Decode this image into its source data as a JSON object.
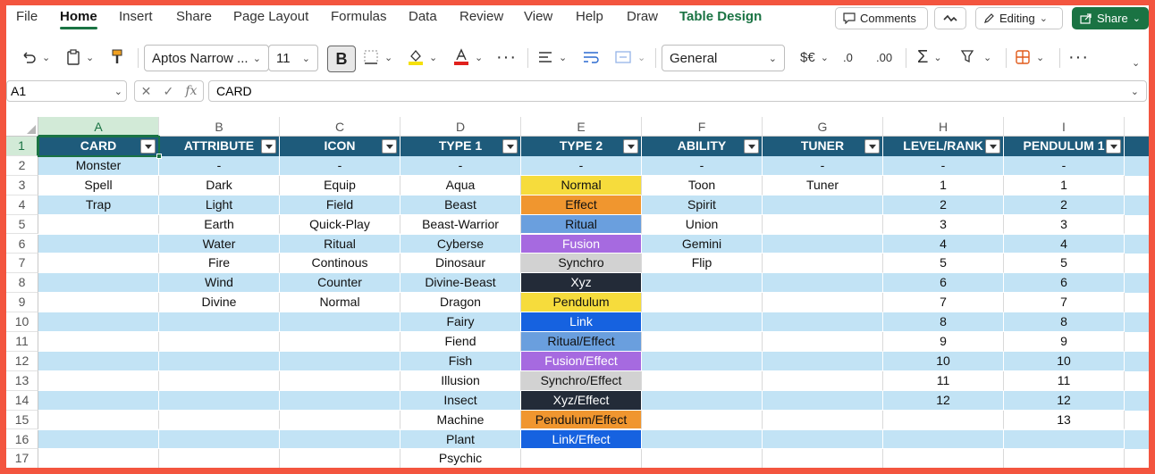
{
  "menu": {
    "items": [
      "File",
      "Home",
      "Insert",
      "Share",
      "Page Layout",
      "Formulas",
      "Data",
      "Review",
      "View",
      "Help",
      "Draw",
      "Table Design"
    ],
    "active": "Home",
    "comments_label": "Comments",
    "editing_label": "Editing",
    "share_label": "Share"
  },
  "toolbar": {
    "font_name": "Aptos Narrow ...",
    "font_size": "11",
    "bold_label": "B",
    "number_format": "General",
    "currency_label": "$€",
    "decimal_increase": ".0",
    "decimal_decrease": ".00",
    "colors": {
      "highlight": "#f5e00a",
      "font_color": "#e0211d",
      "accent": "#1a7343"
    }
  },
  "formula_bar": {
    "name_box": "A1",
    "fx_label": "fx",
    "content": "CARD"
  },
  "columns": [
    "A",
    "B",
    "C",
    "D",
    "E",
    "F",
    "G",
    "H",
    "I"
  ],
  "rows": [
    "1",
    "2",
    "3",
    "4",
    "5",
    "6",
    "7",
    "8",
    "9",
    "10",
    "11",
    "12",
    "13",
    "14",
    "15",
    "16",
    "17"
  ],
  "table": {
    "headers": [
      "CARD",
      "ATTRIBUTE",
      "ICON",
      "TYPE 1",
      "TYPE 2",
      "ABILITY",
      "TUNER",
      "LEVEL/RANK",
      "PENDULUM 1"
    ],
    "data": [
      [
        "Monster",
        "-",
        "-",
        "-",
        "-",
        "-",
        "-",
        "-",
        "-"
      ],
      [
        "Spell",
        "Dark",
        "Equip",
        "Aqua",
        "Normal",
        "Toon",
        "Tuner",
        "1",
        "1"
      ],
      [
        "Trap",
        "Light",
        "Field",
        "Beast",
        "Effect",
        "Spirit",
        "",
        "2",
        "2"
      ],
      [
        "",
        "Earth",
        "Quick-Play",
        "Beast-Warrior",
        "Ritual",
        "Union",
        "",
        "3",
        "3"
      ],
      [
        "",
        "Water",
        "Ritual",
        "Cyberse",
        "Fusion",
        "Gemini",
        "",
        "4",
        "4"
      ],
      [
        "",
        "Fire",
        "Continous",
        "Dinosaur",
        "Synchro",
        "Flip",
        "",
        "5",
        "5"
      ],
      [
        "",
        "Wind",
        "Counter",
        "Divine-Beast",
        "Xyz",
        "",
        "",
        "6",
        "6"
      ],
      [
        "",
        "Divine",
        "Normal",
        "Dragon",
        "Pendulum",
        "",
        "",
        "7",
        "7"
      ],
      [
        "",
        "",
        "",
        "Fairy",
        "Link",
        "",
        "",
        "8",
        "8"
      ],
      [
        "",
        "",
        "",
        "Fiend",
        "Ritual/Effect",
        "",
        "",
        "9",
        "9"
      ],
      [
        "",
        "",
        "",
        "Fish",
        "Fusion/Effect",
        "",
        "",
        "10",
        "10"
      ],
      [
        "",
        "",
        "",
        "Illusion",
        "Synchro/Effect",
        "",
        "",
        "11",
        "11"
      ],
      [
        "",
        "",
        "",
        "Insect",
        "Xyz/Effect",
        "",
        "",
        "12",
        "12"
      ],
      [
        "",
        "",
        "",
        "Machine",
        "Pendulum/Effect",
        "",
        "",
        "",
        "13"
      ],
      [
        "",
        "",
        "",
        "Plant",
        "Link/Effect",
        "",
        "",
        "",
        ""
      ],
      [
        "",
        "",
        "",
        "Psychic",
        "",
        "",
        "",
        "",
        ""
      ]
    ],
    "type2_colors": [
      "",
      "#f6dc3c",
      "#f0962f",
      "#6a9fde",
      "#a66ae0",
      "#d2d2d2",
      "#232b38",
      "#f6dc3c",
      "#1662e0",
      "#6a9fde",
      "#a66ae0",
      "#d2d2d2",
      "#232b38",
      "#f0962f",
      "#1662e0",
      ""
    ],
    "type2_text_colors": [
      "",
      "#111",
      "#111",
      "#111",
      "#fff",
      "#111",
      "#fff",
      "#111",
      "#fff",
      "#111",
      "#fff",
      "#111",
      "#fff",
      "#111",
      "#fff",
      ""
    ],
    "header_color": "#1e5b7b",
    "band_color": "#c2e3f5"
  }
}
